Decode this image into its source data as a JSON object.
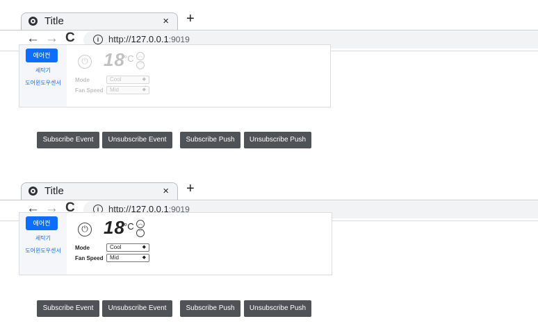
{
  "browser": {
    "tab_title": "Title",
    "tab_close": "×",
    "new_tab": "+",
    "url_scheme": "http://",
    "url_host": "127.0.0.1",
    "url_rest": ":9019"
  },
  "devices": {
    "active": "에어컨",
    "items": [
      "세탁기",
      "도어윈도우센서"
    ]
  },
  "aircon": {
    "temperature": "18",
    "unit": "°C",
    "mode_label": "Mode",
    "mode_value": "Cool",
    "fan_label": "Fan Speed",
    "fan_value": "Mid"
  },
  "buttons": {
    "subscribe_event": "Subscribe Event",
    "unsubscribe_event": "Unsubscribe Event",
    "subscribe_push": "Subscribe Push",
    "unsubscribe_push": "Unsubscribe Push"
  },
  "states": [
    "disabled",
    "enabled"
  ],
  "colors": {
    "primary": "#0d6efd",
    "button_bg": "#4f5358"
  }
}
